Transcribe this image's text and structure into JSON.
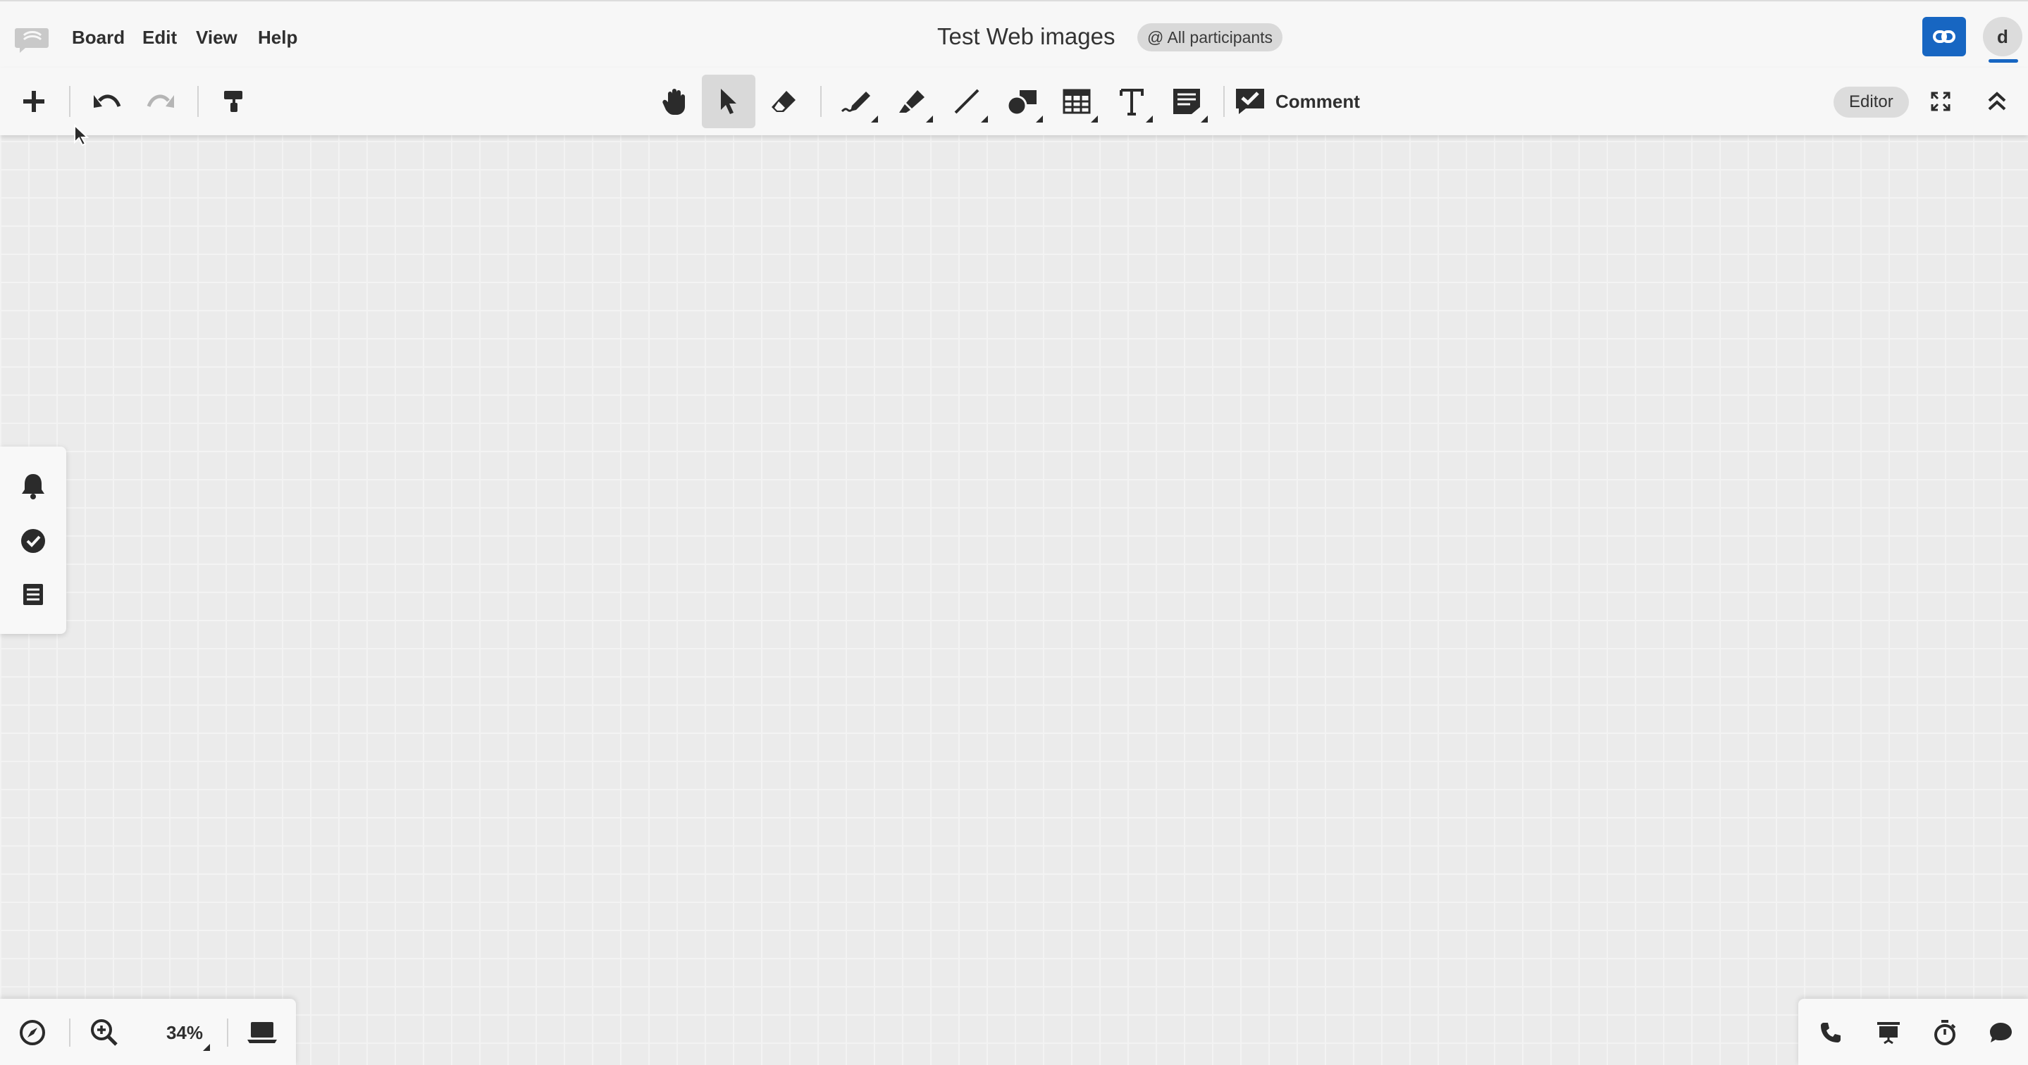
{
  "menubar": {
    "logo_icon": "board-logo-icon",
    "items": [
      {
        "label": "Board"
      },
      {
        "label": "Edit"
      },
      {
        "label": "View"
      },
      {
        "label": "Help"
      }
    ],
    "title": "Test Web images",
    "participants": "@ All participants",
    "share_icon": "link-icon",
    "avatar_initial": "d",
    "accent_color": "#1766c2"
  },
  "toolbar": {
    "left_tools": [
      "add-icon",
      "undo-icon",
      "redo-icon",
      "format-painter-icon"
    ],
    "center_tools": [
      "hand-icon",
      "pointer-icon",
      "eraser-icon",
      "pen-icon",
      "highlighter-icon",
      "line-icon",
      "shapes-icon",
      "table-icon",
      "text-icon",
      "sticky-note-icon"
    ],
    "active_tool": "pointer",
    "comment_label": "Comment",
    "role_label": "Editor",
    "right_tools": [
      "fullscreen-icon",
      "collapse-icon"
    ]
  },
  "left_dock": {
    "items": [
      "bell-icon",
      "check-circle-icon",
      "list-icon"
    ]
  },
  "bottom_left": {
    "items": [
      "compass-icon",
      "zoom-in-icon",
      "laptop-icon"
    ],
    "zoom_level": "34%"
  },
  "bottom_right": {
    "items": [
      "phone-icon",
      "presentation-icon",
      "timer-icon",
      "chat-icon"
    ]
  }
}
